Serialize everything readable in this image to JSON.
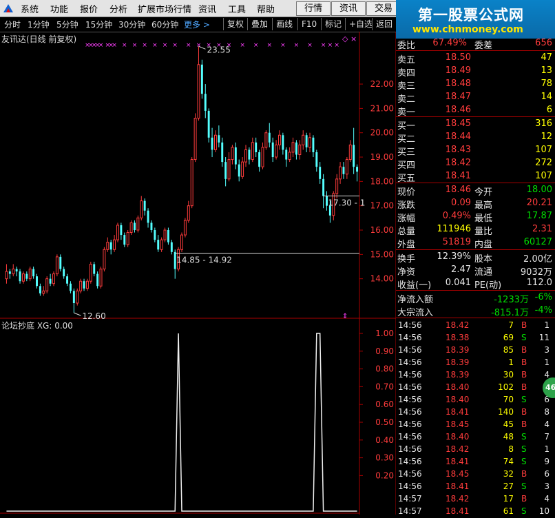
{
  "menu": {
    "items": [
      "系统",
      "功能",
      "报价",
      "分析",
      "扩展市场行情",
      "资讯",
      "工具",
      "帮助"
    ],
    "tabs": [
      "行情",
      "资讯",
      "交易"
    ]
  },
  "watermark": {
    "title": "第一股票公式网",
    "url": "www.chnmoney.com"
  },
  "toolbar": {
    "periods": [
      "分时",
      "1分钟",
      "5分钟",
      "15分钟",
      "30分钟",
      "60分钟"
    ],
    "more_label": "更多 >",
    "tools": [
      "复权",
      "叠加",
      "画线",
      "F10",
      "标记",
      "+自选",
      "返回"
    ]
  },
  "chart": {
    "title": "友讯达(日线 前复权)",
    "labels": {
      "high": "23.55",
      "low": "12.60",
      "range1": "14.85 - 14.92",
      "range2": "17.30 - 1"
    },
    "y_axis": [
      "22.00",
      "21.00",
      "20.00",
      "19.00",
      "18.00",
      "17.00",
      "16.00",
      "15.00",
      "14.00"
    ],
    "ind_title": "论坛抄底 XG: 0.00",
    "ind_axis": [
      "1.00",
      "0.90",
      "0.80",
      "0.70",
      "0.60",
      "0.50",
      "0.40",
      "0.30",
      "0.20"
    ]
  },
  "chart_data": {
    "type": "candlestick",
    "ylim": [
      13.0,
      23.7
    ],
    "candles": [
      [
        14.0,
        14.3,
        14.6,
        13.8
      ],
      [
        14.3,
        14.2,
        14.4,
        14.0
      ],
      [
        14.2,
        14.4,
        14.6,
        14.1
      ],
      [
        14.4,
        14.3,
        14.5,
        14.1
      ],
      [
        14.3,
        13.9,
        14.4,
        13.8
      ],
      [
        13.9,
        14.2,
        14.3,
        13.8
      ],
      [
        14.2,
        14.0,
        14.3,
        13.9
      ],
      [
        14.0,
        14.4,
        14.5,
        13.9
      ],
      [
        14.4,
        14.1,
        14.5,
        14.0
      ],
      [
        14.1,
        13.7,
        14.2,
        13.6
      ],
      [
        13.7,
        13.4,
        13.8,
        13.3
      ],
      [
        13.4,
        13.5,
        13.7,
        13.3
      ],
      [
        13.5,
        14.0,
        14.1,
        13.4
      ],
      [
        14.0,
        13.8,
        14.2,
        13.7
      ],
      [
        13.8,
        14.2,
        14.3,
        13.7
      ],
      [
        14.2,
        14.9,
        15.0,
        14.1
      ],
      [
        14.9,
        14.4,
        15.0,
        14.3
      ],
      [
        14.4,
        14.1,
        14.5,
        14.0
      ],
      [
        14.1,
        13.8,
        14.2,
        13.7
      ],
      [
        13.8,
        13.5,
        13.9,
        13.4
      ],
      [
        13.5,
        13.0,
        13.6,
        12.6
      ],
      [
        13.0,
        13.5,
        13.6,
        12.9
      ],
      [
        13.5,
        13.9,
        14.0,
        13.4
      ],
      [
        13.9,
        13.6,
        14.0,
        13.5
      ],
      [
        13.6,
        13.9,
        14.0,
        13.5
      ],
      [
        13.9,
        14.6,
        14.7,
        13.8
      ],
      [
        14.6,
        14.2,
        14.7,
        14.1
      ],
      [
        14.2,
        13.7,
        14.3,
        13.6
      ],
      [
        13.7,
        14.4,
        14.5,
        13.6
      ],
      [
        14.4,
        15.2,
        15.3,
        14.3
      ],
      [
        15.2,
        15.5,
        15.7,
        15.1
      ],
      [
        15.5,
        15.2,
        15.6,
        15.0
      ],
      [
        15.2,
        15.6,
        15.8,
        15.1
      ],
      [
        15.6,
        16.2,
        16.3,
        15.5
      ],
      [
        16.2,
        15.8,
        16.3,
        15.6
      ],
      [
        15.8,
        15.4,
        15.9,
        15.3
      ],
      [
        15.4,
        15.9,
        16.0,
        15.3
      ],
      [
        15.9,
        16.3,
        16.4,
        15.8
      ],
      [
        16.3,
        16.0,
        16.4,
        15.9
      ],
      [
        16.0,
        16.5,
        16.6,
        15.9
      ],
      [
        16.5,
        17.2,
        17.4,
        16.4
      ],
      [
        17.2,
        16.8,
        17.3,
        16.6
      ],
      [
        16.8,
        16.3,
        16.9,
        16.1
      ],
      [
        16.3,
        16.0,
        16.4,
        15.9
      ],
      [
        16.0,
        15.6,
        16.1,
        15.5
      ],
      [
        15.6,
        15.2,
        15.8,
        15.1
      ],
      [
        15.2,
        15.6,
        15.7,
        15.1
      ],
      [
        15.6,
        16.0,
        16.1,
        15.5
      ],
      [
        16.0,
        15.5,
        16.1,
        15.4
      ],
      [
        15.5,
        15.1,
        15.6,
        15.0
      ],
      [
        15.1,
        14.4,
        15.2,
        14.0
      ],
      [
        14.4,
        15.2,
        15.3,
        14.3
      ],
      [
        15.2,
        15.8,
        15.9,
        15.1
      ],
      [
        15.8,
        16.4,
        16.5,
        15.7
      ],
      [
        16.4,
        17.0,
        17.2,
        16.3
      ],
      [
        17.0,
        18.9,
        19.0,
        16.9
      ],
      [
        18.9,
        20.6,
        20.8,
        18.8
      ],
      [
        20.6,
        22.8,
        23.55,
        20.5
      ],
      [
        22.8,
        21.6,
        23.0,
        21.4
      ],
      [
        21.6,
        20.9,
        22.0,
        20.6
      ],
      [
        20.9,
        19.8,
        21.0,
        19.6
      ],
      [
        19.8,
        19.3,
        20.2,
        19.0
      ],
      [
        19.3,
        19.9,
        20.1,
        19.2
      ],
      [
        19.9,
        19.6,
        20.3,
        19.4
      ],
      [
        19.6,
        18.8,
        19.8,
        18.6
      ],
      [
        18.8,
        18.1,
        19.0,
        17.8
      ],
      [
        18.1,
        18.9,
        19.2,
        18.0
      ],
      [
        18.9,
        19.4,
        19.5,
        18.7
      ],
      [
        19.4,
        18.7,
        19.6,
        18.5
      ],
      [
        18.7,
        18.2,
        18.9,
        18.0
      ],
      [
        18.2,
        18.8,
        19.0,
        18.1
      ],
      [
        18.8,
        19.3,
        19.5,
        18.6
      ],
      [
        19.3,
        18.9,
        19.4,
        18.7
      ],
      [
        18.9,
        19.6,
        19.8,
        18.8
      ],
      [
        19.6,
        19.2,
        19.8,
        19.0
      ],
      [
        19.2,
        18.6,
        19.3,
        18.4
      ],
      [
        18.6,
        19.4,
        19.6,
        18.5
      ],
      [
        19.4,
        20.0,
        20.1,
        19.3
      ],
      [
        20.0,
        19.6,
        20.4,
        19.4
      ],
      [
        19.6,
        19.0,
        19.8,
        18.8
      ],
      [
        19.0,
        19.5,
        19.7,
        18.9
      ],
      [
        19.5,
        19.9,
        20.1,
        19.3
      ],
      [
        19.9,
        19.3,
        20.0,
        19.1
      ],
      [
        19.3,
        18.9,
        19.4,
        18.6
      ],
      [
        18.9,
        19.2,
        19.4,
        18.8
      ],
      [
        19.2,
        19.6,
        19.8,
        19.0
      ],
      [
        19.6,
        19.1,
        19.7,
        18.9
      ],
      [
        19.1,
        19.5,
        19.7,
        18.9
      ],
      [
        19.5,
        19.9,
        20.1,
        19.3
      ],
      [
        19.9,
        19.4,
        20.0,
        19.2
      ],
      [
        19.4,
        19.8,
        20.0,
        19.2
      ],
      [
        19.8,
        19.2,
        19.9,
        19.0
      ],
      [
        19.2,
        18.6,
        19.3,
        18.4
      ],
      [
        18.6,
        18.1,
        18.8,
        17.9
      ],
      [
        18.1,
        17.4,
        18.3,
        16.9
      ],
      [
        17.4,
        17.0,
        17.6,
        16.8
      ],
      [
        17.0,
        16.6,
        17.2,
        16.3
      ],
      [
        16.6,
        17.5,
        17.6,
        16.4
      ],
      [
        17.5,
        18.1,
        18.3,
        17.3
      ],
      [
        18.1,
        18.6,
        18.8,
        17.9
      ],
      [
        18.6,
        18.3,
        18.8,
        18.1
      ],
      [
        18.3,
        18.9,
        19.0,
        18.1
      ],
      [
        18.9,
        19.5,
        19.7,
        18.8
      ],
      [
        19.5,
        18.6,
        20.2,
        18.3
      ],
      [
        18.6,
        18.4,
        18.7,
        18.0
      ]
    ],
    "indicator": {
      "type": "line",
      "spikes": [
        {
          "index": 51,
          "value": 1.0
        },
        {
          "index": 92,
          "value": 1.0
        },
        {
          "index": 93,
          "value": 1.0
        }
      ],
      "ylim": [
        0,
        1.0
      ]
    }
  },
  "quote": {
    "weibi": {
      "label": "委比",
      "pct": "67.49%",
      "label2": "委差",
      "value": "656"
    },
    "sell": [
      {
        "label": "卖五",
        "price": "18.50",
        "vol": "47"
      },
      {
        "label": "卖四",
        "price": "18.49",
        "vol": "13"
      },
      {
        "label": "卖三",
        "price": "18.48",
        "vol": "78"
      },
      {
        "label": "卖二",
        "price": "18.47",
        "vol": "14"
      },
      {
        "label": "卖一",
        "price": "18.46",
        "vol": "6"
      }
    ],
    "buy": [
      {
        "label": "买一",
        "price": "18.45",
        "vol": "316"
      },
      {
        "label": "买二",
        "price": "18.44",
        "vol": "12"
      },
      {
        "label": "买三",
        "price": "18.43",
        "vol": "107"
      },
      {
        "label": "买四",
        "price": "18.42",
        "vol": "272"
      },
      {
        "label": "买五",
        "price": "18.41",
        "vol": "107"
      }
    ],
    "stats": [
      {
        "l1": "现价",
        "v1": "18.46",
        "c1": "red",
        "l2": "今开",
        "v2": "18.00",
        "c2": "green"
      },
      {
        "l1": "涨跌",
        "v1": "0.09",
        "c1": "red",
        "l2": "最高",
        "v2": "20.21",
        "c2": "red"
      },
      {
        "l1": "涨幅",
        "v1": "0.49%",
        "c1": "red",
        "l2": "最低",
        "v2": "17.87",
        "c2": "green"
      },
      {
        "l1": "总量",
        "v1": "111946",
        "c1": "yel",
        "l2": "量比",
        "v2": "2.31",
        "c2": "red"
      },
      {
        "l1": "外盘",
        "v1": "51819",
        "c1": "red",
        "l2": "内盘",
        "v2": "60127",
        "c2": "green"
      }
    ],
    "fund": [
      {
        "l1": "换手",
        "v1": "12.39%",
        "l2": "股本",
        "v2": "2.00亿"
      },
      {
        "l1": "净资",
        "v1": "2.47",
        "l2": "流通",
        "v2": "9032万"
      },
      {
        "l1": "收益(一)",
        "v1": "0.041",
        "l2": "PE(动)",
        "v2": "112.0"
      }
    ],
    "flow": [
      {
        "label": "净流入额",
        "value": "-1233万",
        "pct": "-6%"
      },
      {
        "label": "大宗流入",
        "value": "-815.1万",
        "pct": "-4%"
      }
    ]
  },
  "ticks": [
    {
      "time": "14:56",
      "price": "18.42",
      "vol": "7",
      "bs": "B",
      "n": "1"
    },
    {
      "time": "14:56",
      "price": "18.38",
      "vol": "69",
      "bs": "S",
      "n": "11"
    },
    {
      "time": "14:56",
      "price": "18.39",
      "vol": "85",
      "bs": "B",
      "n": "3"
    },
    {
      "time": "14:56",
      "price": "18.39",
      "vol": "1",
      "bs": "B",
      "n": "1"
    },
    {
      "time": "14:56",
      "price": "18.39",
      "vol": "30",
      "bs": "B",
      "n": "4"
    },
    {
      "time": "14:56",
      "price": "18.40",
      "vol": "102",
      "bs": "B",
      "n": "6"
    },
    {
      "time": "14:56",
      "price": "18.40",
      "vol": "70",
      "bs": "S",
      "n": "6"
    },
    {
      "time": "14:56",
      "price": "18.41",
      "vol": "140",
      "bs": "B",
      "n": "8"
    },
    {
      "time": "14:56",
      "price": "18.45",
      "vol": "45",
      "bs": "B",
      "n": "4"
    },
    {
      "time": "14:56",
      "price": "18.40",
      "vol": "48",
      "bs": "S",
      "n": "7"
    },
    {
      "time": "14:56",
      "price": "18.42",
      "vol": "8",
      "bs": "S",
      "n": "1"
    },
    {
      "time": "14:56",
      "price": "18.41",
      "vol": "74",
      "bs": "S",
      "n": "9"
    },
    {
      "time": "14:56",
      "price": "18.45",
      "vol": "32",
      "bs": "B",
      "n": "6"
    },
    {
      "time": "14:56",
      "price": "18.41",
      "vol": "27",
      "bs": "S",
      "n": "3"
    },
    {
      "time": "14:57",
      "price": "18.42",
      "vol": "17",
      "bs": "B",
      "n": "4"
    },
    {
      "time": "14:57",
      "price": "18.41",
      "vol": "61",
      "bs": "S",
      "n": "10"
    }
  ],
  "badge": "46"
}
